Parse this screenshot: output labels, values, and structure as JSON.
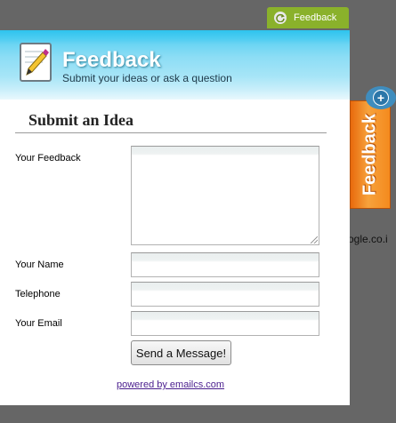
{
  "tab": {
    "label": "Feedback",
    "icon": "refresh-icon"
  },
  "header": {
    "title": "Feedback",
    "subtitle": "Submit your ideas or ask a question",
    "icon": "pencil-note-icon"
  },
  "form": {
    "section_title": "Submit an Idea",
    "feedback_label": "Your Feedback",
    "feedback_value": "",
    "name_label": "Your Name",
    "name_value": "",
    "telephone_label": "Telephone",
    "telephone_value": "",
    "email_label": "Your Email",
    "email_value": "",
    "submit_label": "Send a Message!"
  },
  "footer": {
    "powered_by": "powered by emailcs.com"
  },
  "side_widget": {
    "label": "Feedback",
    "badge_icon": "plus-icon"
  },
  "background": {
    "snippet": "ogle.co.i"
  },
  "colors": {
    "page_background": "#666666",
    "tab_green": "#8ab12b",
    "header_blue": "#2ec3ee",
    "widget_orange": "#f48a1e",
    "link_purple": "#4a1e8e"
  }
}
